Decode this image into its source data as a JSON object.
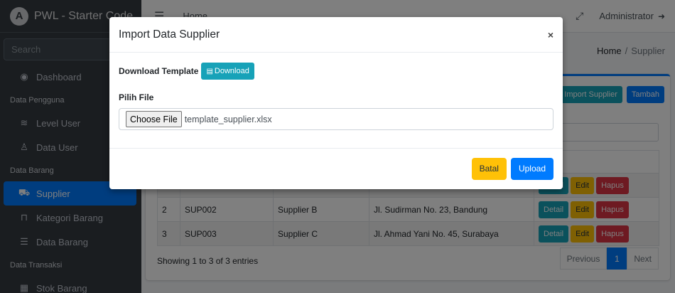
{
  "sidebar": {
    "brand_logo": "A",
    "brand": "PWL - Starter Code",
    "search_placeholder": "Search",
    "dashboard": "Dashboard",
    "section_pengguna": "Data Pengguna",
    "level_user": "Level User",
    "data_user": "Data User",
    "section_barang": "Data Barang",
    "supplier": "Supplier",
    "kategori_barang": "Kategori Barang",
    "data_barang": "Data Barang",
    "section_transaksi": "Data Transaksi",
    "stok_barang": "Stok Barang"
  },
  "navbar": {
    "home": "Home",
    "user": "Administrator"
  },
  "breadcrumb": {
    "home": "Home",
    "sep": "/",
    "current": "Supplier"
  },
  "card": {
    "import_button": "Import Supplier",
    "add_button": "Tambah"
  },
  "table": {
    "rows": [
      {
        "no": "2",
        "kode": "SUP002",
        "nama": "Supplier B",
        "alamat": "Jl. Sudirman No. 23, Bandung"
      },
      {
        "no": "3",
        "kode": "SUP003",
        "nama": "Supplier C",
        "alamat": "Jl. Ahmad Yani No. 45, Surabaya"
      }
    ],
    "detail": "Detail",
    "edit": "Edit",
    "hapus": "Hapus"
  },
  "footer": {
    "info": "Showing 1 to 3 of 3 entries",
    "previous": "Previous",
    "page": "1",
    "next": "Next"
  },
  "modal": {
    "title": "Import Data Supplier",
    "close": "×",
    "download_label": "Download Template",
    "download_button": "Download",
    "file_label": "Pilih File",
    "choose_file": "Choose File",
    "file_name": "template_supplier.xlsx",
    "cancel": "Batal",
    "upload": "Upload"
  },
  "colors": {
    "primary": "#007bff",
    "info": "#17a2b8",
    "warning": "#ffc107",
    "danger": "#dc3545",
    "sidebar": "#343a40"
  }
}
